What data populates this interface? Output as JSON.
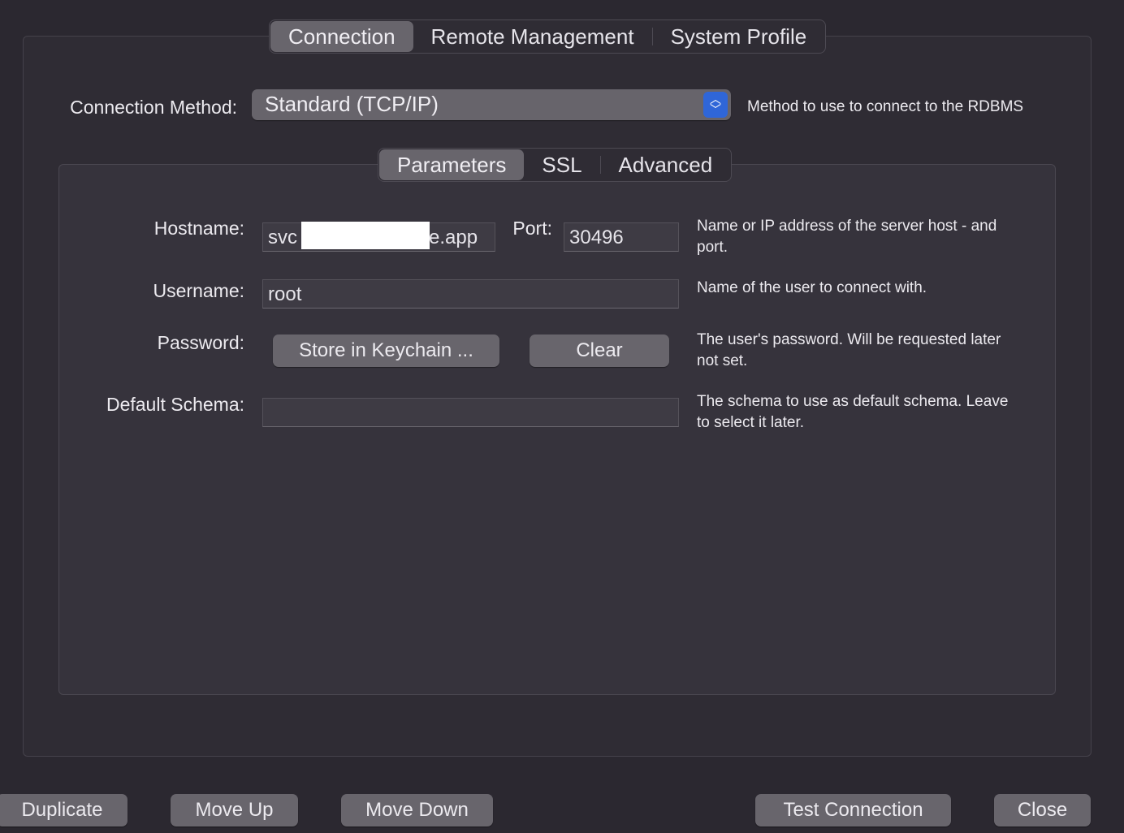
{
  "top_tabs": [
    {
      "label": "Connection",
      "selected": true
    },
    {
      "label": "Remote Management",
      "selected": false
    },
    {
      "label": "System Profile",
      "selected": false
    }
  ],
  "connection_method": {
    "label": "Connection Method:",
    "value": "Standard (TCP/IP)",
    "help": "Method to use to connect to the RDBMS"
  },
  "sub_tabs": [
    {
      "label": "Parameters",
      "selected": true
    },
    {
      "label": "SSL",
      "selected": false
    },
    {
      "label": "Advanced",
      "selected": false
    }
  ],
  "params": {
    "hostname_label": "Hostname:",
    "hostname_prefix": "svc",
    "hostname_suffix": "e.app",
    "port_label": "Port:",
    "port_value": "30496",
    "hostname_help": "Name or IP address of the server host - and\nport.",
    "username_label": "Username:",
    "username_value": "root",
    "username_help": "Name of the user to connect with.",
    "password_label": "Password:",
    "store_keychain": "Store in Keychain ...",
    "clear": "Clear",
    "password_help": "The user's password. Will be requested later\nnot set.",
    "schema_label": "Default Schema:",
    "schema_value": "",
    "schema_help": "The schema to use as default schema. Leave\nto select it later."
  },
  "bottom_buttons": {
    "duplicate": "Duplicate",
    "move_up": "Move Up",
    "move_down": "Move Down",
    "test_connection": "Test Connection",
    "close": "Close"
  },
  "colors": {
    "accent": "#2f66d8",
    "background": "#2b2830"
  }
}
